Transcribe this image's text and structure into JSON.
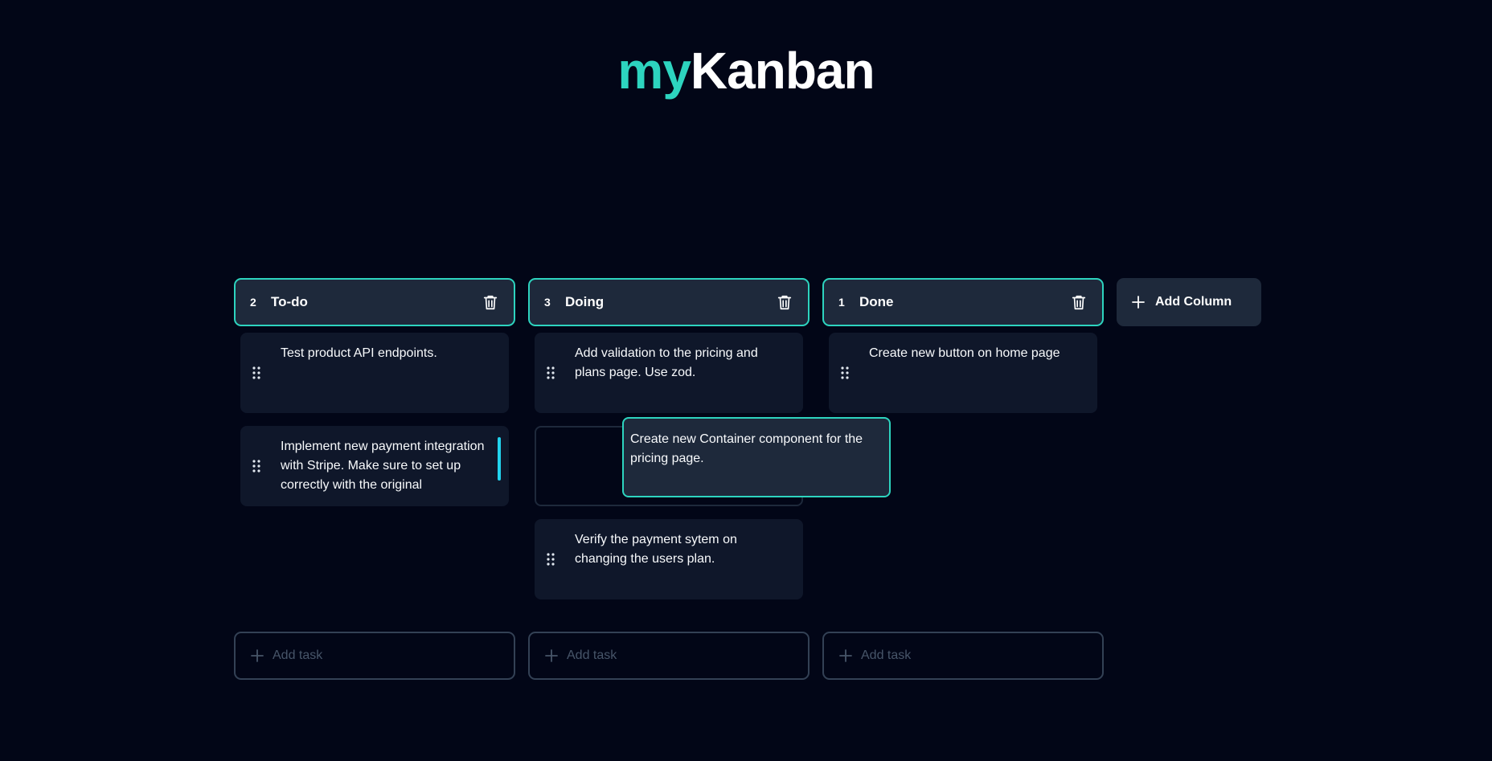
{
  "app": {
    "logo_prefix": "my",
    "logo_suffix": "Kanban"
  },
  "columns": [
    {
      "count": "2",
      "title": "To-do",
      "tasks": [
        "Test product API endpoints.",
        "Implement new payment integration with Stripe. Make sure to set up correctly with the original"
      ],
      "add_task_label": "Add task"
    },
    {
      "count": "3",
      "title": "Doing",
      "tasks": [
        "Add validation to the pricing and plans page. Use zod.",
        "Verify the payment sytem on changing the users plan."
      ],
      "add_task_label": "Add task"
    },
    {
      "count": "1",
      "title": "Done",
      "tasks": [
        "Create new button on home page"
      ],
      "add_task_label": "Add task"
    }
  ],
  "dragging_task": "Create new Container component for the pricing page.",
  "add_column_label": "Add Column",
  "icons": {
    "delete": "trash-icon",
    "drag": "grip-icon",
    "add": "plus-icon"
  },
  "colors": {
    "accent": "#2dd4bf",
    "background": "#020617",
    "column_header": "#1e293b",
    "card": "#0f172a",
    "scroll_indicator": "#22d3ee"
  }
}
